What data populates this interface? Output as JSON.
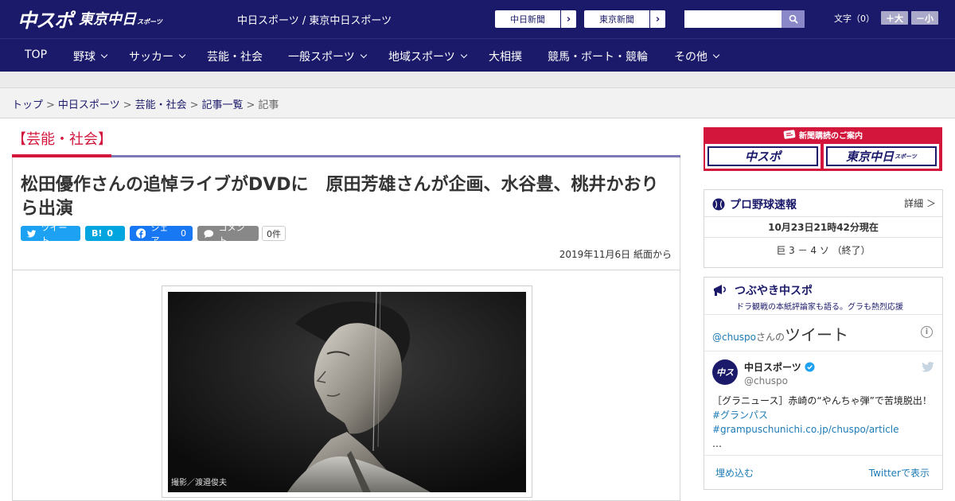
{
  "header": {
    "logo_main": "中スポ",
    "logo_tokyo": "東京中日",
    "logo_tokyo_small": "スポーツ",
    "site_title": "中日スポーツ / 東京中日スポーツ",
    "link1": "中日新聞",
    "link2": "東京新聞",
    "font_label": "文字（0）",
    "font_plus": "＋大",
    "font_minus": "－小",
    "search_placeholder": ""
  },
  "nav": {
    "items": [
      "TOP",
      "野球",
      "サッカー",
      "芸能・社会",
      "一般スポーツ",
      "地域スポーツ",
      "大相撲",
      "競馬・ボート・競輪",
      "その他"
    ]
  },
  "breadcrumb": {
    "items": [
      "トップ",
      "中日スポーツ",
      "芸能・社会",
      "記事一覧",
      "記事"
    ],
    "sep": ">"
  },
  "article": {
    "category": "【芸能・社会】",
    "headline": "松田優作さんの追悼ライブがDVDに　原田芳雄さんが企画、水谷豊、桃井かおりら出演",
    "share": {
      "tweet": "ツイート",
      "hatena_count": "0",
      "facebook": "シェア",
      "facebook_count": "0",
      "comment": "コメント",
      "comment_count": "0件"
    },
    "date": "2019年11月6日 紙面から",
    "photo_credit": "撮影／渡邉俊夫"
  },
  "sidebar": {
    "subscription": {
      "heading": "新聞購読のご案内",
      "btn1": "中スポ",
      "btn2": "東京中日",
      "btn2_small": "スポーツ"
    },
    "baseball": {
      "title": "プロ野球速報",
      "more": "詳細 ＞",
      "time": "10月23日21時42分現在",
      "score": "巨 3 － 4 ソ （終了）"
    },
    "tweets": {
      "title": "つぶやき中スポ",
      "subtitle": "ドラ観戦の本紙評論家も語る。グラも熱烈応援",
      "handle_link": "@chuspo",
      "by_text": "さんの",
      "by_big": "ツイート",
      "name": "中日スポーツ",
      "handle": "@chuspo",
      "text_plain": "［グラニュース］赤崎の“やんちゃ弾”で苦境脱出！",
      "text_link": "#グランパス #grampuschunichi.co.jp/chuspo/article",
      "text_more": "…",
      "embed": "埋め込む",
      "view_on": "Twitterで表示"
    }
  }
}
